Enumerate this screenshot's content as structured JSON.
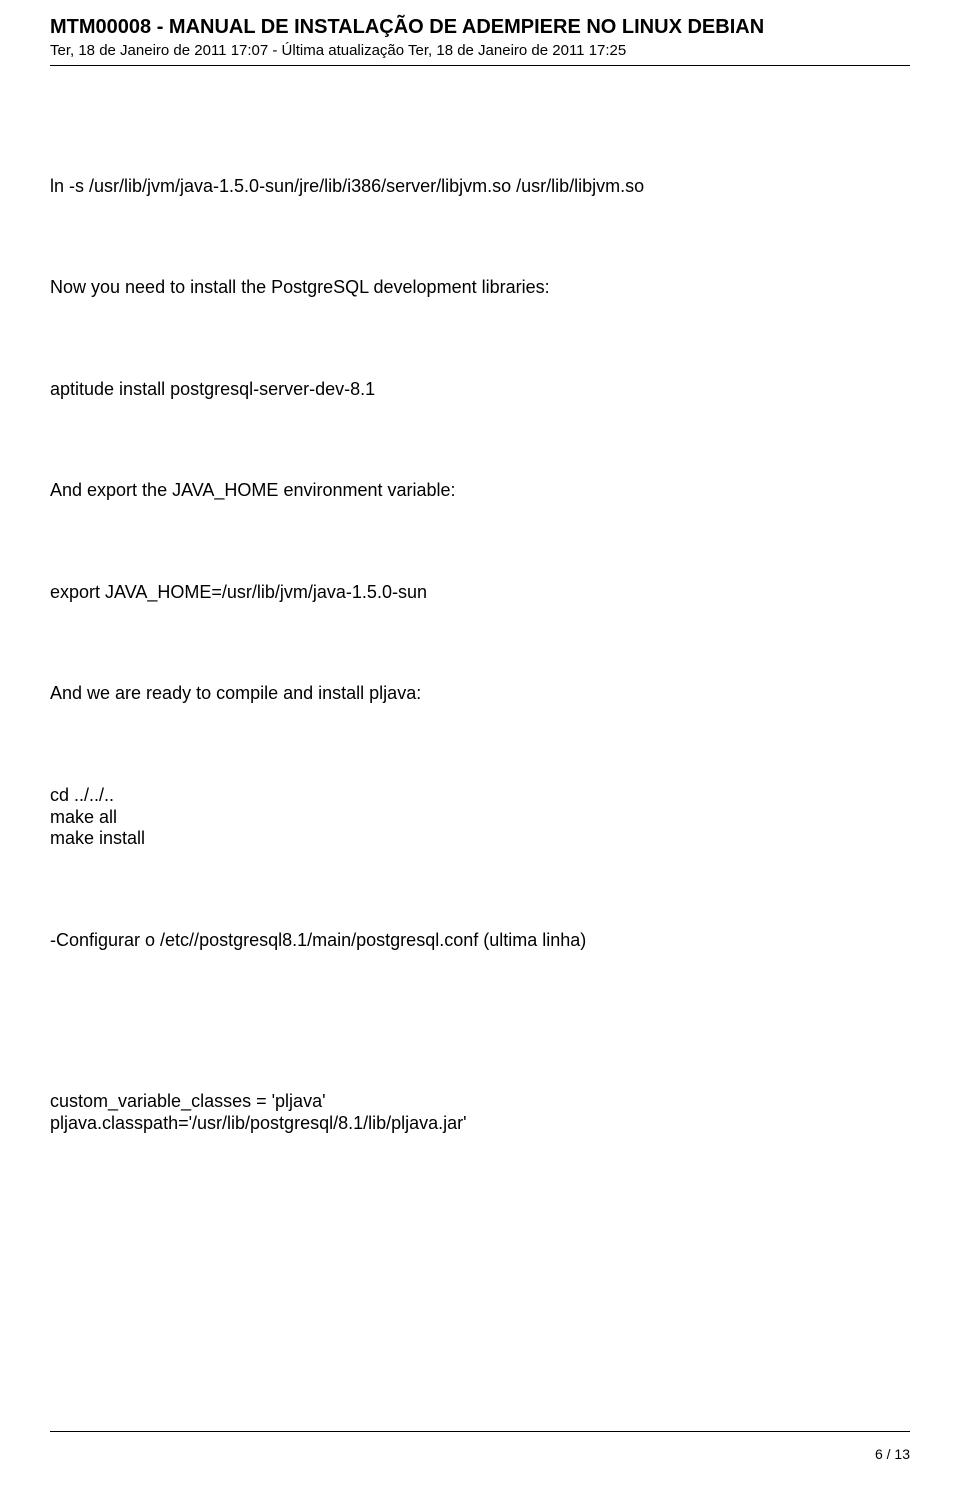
{
  "header": {
    "title": "MTM00008 - MANUAL DE INSTALAÇÃO DE ADEMPIERE NO LINUX DEBIAN",
    "dates": "Ter, 18 de Janeiro de 2011 17:07 - Última atualização Ter, 18 de Janeiro de 2011 17:25"
  },
  "body": {
    "p1": "ln -s /usr/lib/jvm/java-1.5.0-sun/jre/lib/i386/server/libjvm.so /usr/lib/libjvm.so",
    "p2": "Now you need to install the PostgreSQL development libraries:",
    "p3": "aptitude install postgresql-server-dev-8.1",
    "p4": "And export the JAVA_HOME environment variable:",
    "p5": "export JAVA_HOME=/usr/lib/jvm/java-1.5.0-sun",
    "p6": "And we are ready to compile and install pljava:",
    "p7_l1": "cd ../../..",
    "p7_l2": "make all",
    "p7_l3": "make install",
    "p8": "-Configurar o /etc//postgresql8.1/main/postgresql.conf (ultima linha)",
    "p9_l1": "custom_variable_classes = 'pljava'",
    "p9_l2": "pljava.classpath='/usr/lib/postgresql/8.1/lib/pljava.jar'"
  },
  "footer": {
    "page": "6 / 13"
  }
}
